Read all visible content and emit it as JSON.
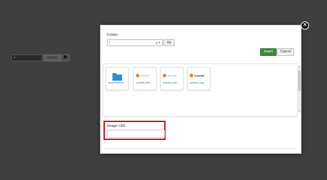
{
  "background": {
    "delete_label": "Delete",
    "clear_icon": "close-x-icon"
  },
  "modal": {
    "folder_label": "Folder",
    "folder_value": "/",
    "up_label": "Up",
    "insert_label": "Insert",
    "cancel_label": "Cancel",
    "items": [
      {
        "label": "documentat...",
        "kind": "folder"
      },
      {
        "label": "joomla_bla...",
        "kind": "image",
        "logo_text": "Joomla!"
      },
      {
        "label": "joomla_pre...",
        "kind": "image",
        "logo_text": "Joomla!"
      },
      {
        "label": "joomla_log...",
        "kind": "image",
        "logo_text": "Joomla!"
      }
    ],
    "image_url_label": "Image URL",
    "image_url_value": ""
  },
  "colors": {
    "insert": "#3d8b3d",
    "highlight": "#d0121b",
    "link": "#1a6aa5",
    "folder_icon": "#2a8fd6"
  }
}
